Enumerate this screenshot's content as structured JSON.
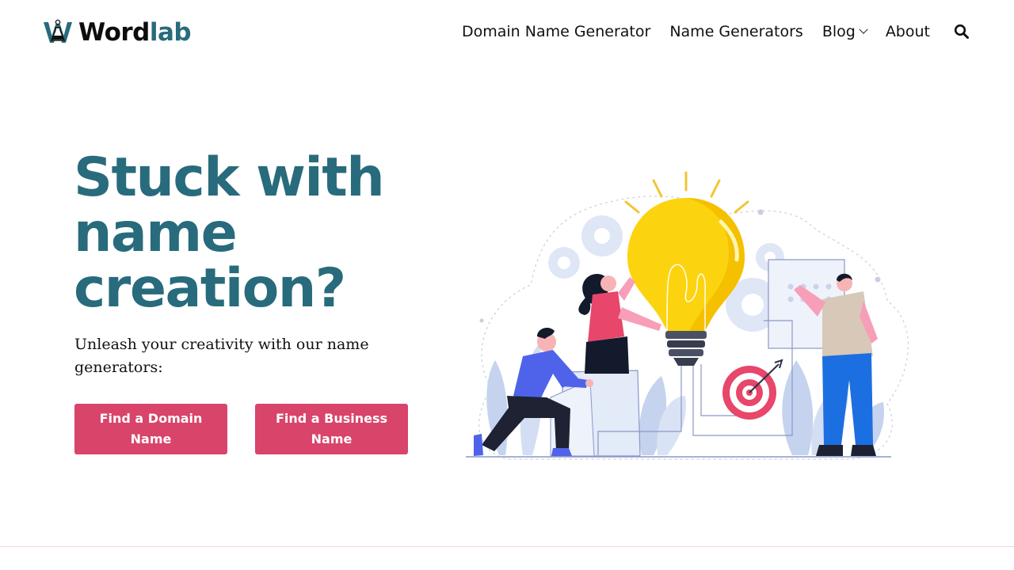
{
  "brand": {
    "name_part1": "Word",
    "name_part2": "lab",
    "primary_color": "#286b7c",
    "accent_color": "#d8446a"
  },
  "nav": {
    "items": [
      {
        "label": "Domain Name Generator"
      },
      {
        "label": "Name Generators"
      },
      {
        "label": "Blog",
        "has_dropdown": true
      },
      {
        "label": "About"
      }
    ],
    "search_icon": "search-icon"
  },
  "hero": {
    "title": "Stuck with name creation?",
    "subtitle": "Unleash your creativity with our name generators:",
    "buttons": [
      {
        "label": "Find a Domain Name"
      },
      {
        "label": "Find a Business Name"
      }
    ],
    "illustration": "lightbulb-teamwork-illustration"
  }
}
